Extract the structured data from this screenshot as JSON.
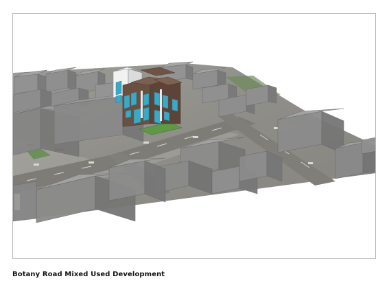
{
  "caption": "Botany Road Mixed Used Development",
  "colors": {
    "ground": "#8f8f8a",
    "road": "#7b7b77",
    "massing": "#8a8a8a",
    "glazing": "#39a9c4",
    "brown_cladding": "#6b5244",
    "white_cladding": "#f4f4f4",
    "landscape": "#5c9a45"
  }
}
